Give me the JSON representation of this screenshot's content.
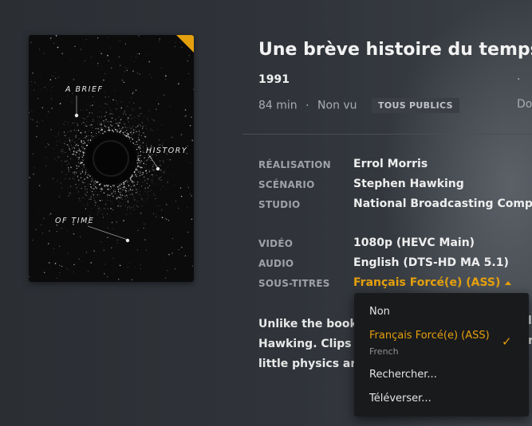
{
  "poster": {
    "line1": "A BRIEF",
    "line2": "HISTORY",
    "line3": "OF TIME"
  },
  "movie": {
    "title": "Une brève histoire du temps",
    "year": "1991",
    "duration": "84 min",
    "separator": "·",
    "watch_status": "Non vu",
    "rating_badge": "TOUS PUBLICS",
    "meta_right_fragment": "Do",
    "year_right_dot": "·"
  },
  "credits": [
    {
      "label": "RÉALISATION",
      "value": "Errol Morris"
    },
    {
      "label": "SCÉNARIO",
      "value": "Stephen Hawking"
    },
    {
      "label": "STUDIO",
      "value": "National Broadcasting Company"
    }
  ],
  "tech": [
    {
      "label": "VIDÉO",
      "value": "1080p (HEVC Main)"
    },
    {
      "label": "AUDIO",
      "value": "English (DTS-HD MA 5.1)"
    },
    {
      "label": "SOUS-TITRES",
      "value": "Français Forcé(e) (ASS)"
    }
  ],
  "description": {
    "line1": "Unlike the book,",
    "line2": "Hawking. Clips of",
    "line3": "little physics are",
    "right1": "l",
    "right2": "r"
  },
  "subtitle_menu": {
    "items": [
      {
        "label": "Non"
      },
      {
        "label": "Français Forcé(e) (ASS)",
        "sublabel": "French",
        "selected": true
      },
      {
        "label": "Rechercher..."
      },
      {
        "label": "Téléverser..."
      }
    ],
    "check_mark": "✓"
  },
  "colors": {
    "accent": "#e5a00d",
    "background": "#2f3338",
    "menu_bg": "#191a1c"
  }
}
